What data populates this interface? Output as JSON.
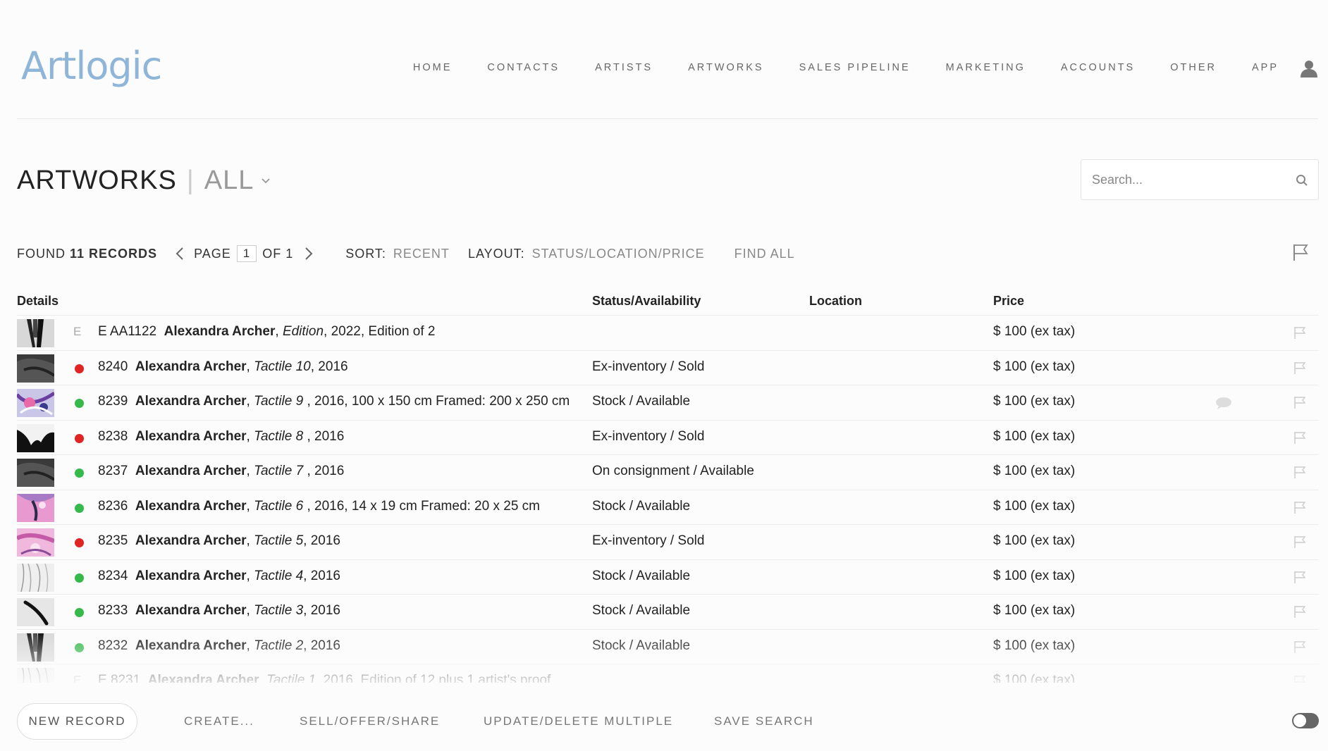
{
  "brand": {
    "logo_text": "Artlogic",
    "logo_color": "#8fb6d9"
  },
  "nav": [
    {
      "label": "HOME"
    },
    {
      "label": "CONTACTS"
    },
    {
      "label": "ARTISTS"
    },
    {
      "label": "ARTWORKS"
    },
    {
      "label": "SALES PIPELINE"
    },
    {
      "label": "MARKETING"
    },
    {
      "label": "ACCOUNTS"
    },
    {
      "label": "OTHER"
    },
    {
      "label": "APP"
    }
  ],
  "page": {
    "title": "ARTWORKS",
    "separator": "|",
    "filter": "ALL"
  },
  "search": {
    "placeholder": "Search..."
  },
  "toolbar": {
    "found_prefix": "FOUND",
    "found_count": "11 RECORDS",
    "page_label": "PAGE",
    "page_current": "1",
    "page_of": "OF 1",
    "sort_label": "SORT:",
    "sort_value": "RECENT",
    "layout_label": "LAYOUT:",
    "layout_value": "STATUS/LOCATION/PRICE",
    "find_all": "FIND ALL"
  },
  "columns": {
    "details": "Details",
    "status": "Status/Availability",
    "location": "Location",
    "price": "Price"
  },
  "status_colors": {
    "sold": "#e02424",
    "available": "#35b94a"
  },
  "rows": [
    {
      "marker": "E",
      "dot": "",
      "id": "E AA1122",
      "artist": "Alexandra Archer",
      "title": "Edition",
      "rest": ", 2022, Edition of 2",
      "status": "",
      "location": "",
      "price": "$ 100 (ex tax)",
      "comment": false,
      "thumb": "dark-figure"
    },
    {
      "marker": "",
      "dot": "sold",
      "id": "8240",
      "artist": "Alexandra Archer",
      "title": "Tactile 10",
      "rest": ", 2016",
      "status": "Ex-inventory / Sold",
      "location": "",
      "price": "$ 100 (ex tax)",
      "comment": false,
      "thumb": "dark-grey"
    },
    {
      "marker": "",
      "dot": "available",
      "id": "8239",
      "artist": "Alexandra Archer",
      "title": "Tactile 9",
      "rest": " , 2016, 100 x 150 cm Framed: 200 x 250 cm",
      "status": "Stock / Available",
      "location": "",
      "price": "$ 100 (ex tax)",
      "comment": true,
      "thumb": "purple-abstract"
    },
    {
      "marker": "",
      "dot": "sold",
      "id": "8238",
      "artist": "Alexandra Archer",
      "title": "Tactile 8",
      "rest": " , 2016",
      "status": "Ex-inventory / Sold",
      "location": "",
      "price": "$ 100 (ex tax)",
      "comment": false,
      "thumb": "black-white"
    },
    {
      "marker": "",
      "dot": "available",
      "id": "8237",
      "artist": "Alexandra Archer",
      "title": "Tactile 7",
      "rest": " , 2016",
      "status": "On consignment / Available",
      "location": "",
      "price": "$ 100 (ex tax)",
      "comment": false,
      "thumb": "dark-grey"
    },
    {
      "marker": "",
      "dot": "available",
      "id": "8236",
      "artist": "Alexandra Archer",
      "title": "Tactile 6",
      "rest": " , 2016, 14 x 19 cm Framed: 20 x 25 cm",
      "status": "Stock / Available",
      "location": "",
      "price": "$ 100 (ex tax)",
      "comment": false,
      "thumb": "pink-purple"
    },
    {
      "marker": "",
      "dot": "sold",
      "id": "8235",
      "artist": "Alexandra Archer",
      "title": "Tactile 5",
      "rest": ", 2016",
      "status": "Ex-inventory / Sold",
      "location": "",
      "price": "$ 100 (ex tax)",
      "comment": false,
      "thumb": "pink"
    },
    {
      "marker": "",
      "dot": "available",
      "id": "8234",
      "artist": "Alexandra Archer",
      "title": "Tactile 4",
      "rest": ", 2016",
      "status": "Stock / Available",
      "location": "",
      "price": "$ 100 (ex tax)",
      "comment": false,
      "thumb": "light-grey"
    },
    {
      "marker": "",
      "dot": "available",
      "id": "8233",
      "artist": "Alexandra Archer",
      "title": "Tactile 3",
      "rest": ", 2016",
      "status": "Stock / Available",
      "location": "",
      "price": "$ 100 (ex tax)",
      "comment": false,
      "thumb": "stroke"
    },
    {
      "marker": "",
      "dot": "available",
      "id": "8232",
      "artist": "Alexandra Archer",
      "title": "Tactile 2",
      "rest": ", 2016",
      "status": "Stock / Available",
      "location": "",
      "price": "$ 100 (ex tax)",
      "comment": false,
      "thumb": "dark-figure"
    },
    {
      "marker": "E",
      "dot": "",
      "id": "E 8231",
      "artist": "Alexandra Archer",
      "title": "Tactile 1",
      "rest": ", 2016, Edition of 12 plus 1 artist's proof",
      "status": "",
      "location": "",
      "price": "$ 100 (ex tax)",
      "comment": false,
      "thumb": "light-grey"
    }
  ],
  "footer": {
    "new_record": "NEW RECORD",
    "create": "CREATE...",
    "sell": "SELL/OFFER/SHARE",
    "update": "UPDATE/DELETE MULTIPLE",
    "save_search": "SAVE SEARCH"
  }
}
